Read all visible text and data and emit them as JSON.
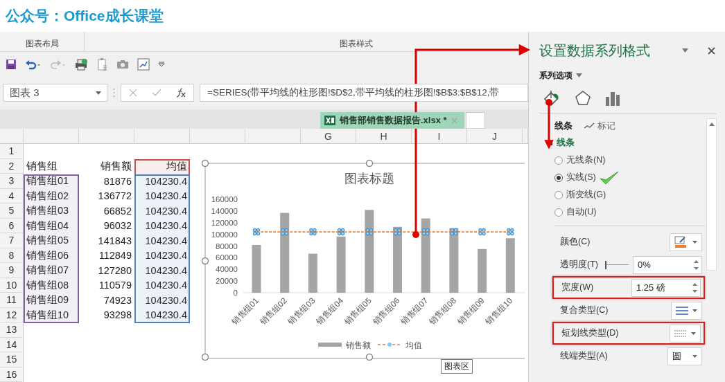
{
  "header": {
    "title": "公众号：Office成长课堂"
  },
  "ribbon": {
    "groups": [
      {
        "label": "图表布局"
      },
      {
        "label": "图表样式"
      }
    ]
  },
  "formula_bar": {
    "name_box": "图表 3",
    "formula": "=SERIES(带平均线的柱形图!$D$2,带平均线的柱形图!$B$3:$B$12,带"
  },
  "tabs": [
    {
      "label": "销售部销售数据报告.xlsx *",
      "selected": true
    }
  ],
  "columns": [
    "G",
    "H",
    "I",
    "J"
  ],
  "sheet": {
    "row_numbers": [
      "1",
      "2",
      "3",
      "4",
      "5",
      "6",
      "7",
      "8",
      "9",
      "10",
      "11",
      "12",
      "13",
      "14",
      "15",
      "16"
    ],
    "header": [
      "销售组",
      "销售额",
      "均值"
    ],
    "rows": [
      [
        "销售组01",
        "81876",
        "104230.4"
      ],
      [
        "销售组02",
        "136772",
        "104230.4"
      ],
      [
        "销售组03",
        "66852",
        "104230.4"
      ],
      [
        "销售组04",
        "96032",
        "104230.4"
      ],
      [
        "销售组05",
        "141843",
        "104230.4"
      ],
      [
        "销售组06",
        "112849",
        "104230.4"
      ],
      [
        "销售组07",
        "127280",
        "104230.4"
      ],
      [
        "销售组08",
        "110579",
        "104230.4"
      ],
      [
        "销售组09",
        "74923",
        "104230.4"
      ],
      [
        "销售组10",
        "93298",
        "104230.4"
      ]
    ]
  },
  "chart": {
    "tooltip": "图表区",
    "chart_data": {
      "type": "bar",
      "title": "图表标题",
      "categories": [
        "销售组01",
        "销售组02",
        "销售组03",
        "销售组04",
        "销售组05",
        "销售组06",
        "销售组07",
        "销售组08",
        "销售组09",
        "销售组10"
      ],
      "series": [
        {
          "name": "销售额",
          "type": "bar",
          "color": "#a5a5a5",
          "values": [
            81876,
            136772,
            66852,
            96032,
            141843,
            112849,
            127280,
            110579,
            74923,
            93298
          ]
        },
        {
          "name": "均值",
          "type": "line",
          "color": "#ed7d31",
          "line_style": "dashed",
          "marker": "cross",
          "values": [
            104230.4,
            104230.4,
            104230.4,
            104230.4,
            104230.4,
            104230.4,
            104230.4,
            104230.4,
            104230.4,
            104230.4
          ]
        }
      ],
      "legend": "bottom",
      "ylim": [
        0,
        160000
      ],
      "yticks": [
        0,
        20000,
        40000,
        60000,
        80000,
        100000,
        120000,
        140000,
        160000
      ]
    }
  },
  "pane": {
    "title": "设置数据系列格式",
    "series_options": "系列选项",
    "tabs": [
      {
        "label": "线条",
        "selected": true
      },
      {
        "label": "标记",
        "selected": false
      }
    ],
    "section": {
      "label": "线条"
    },
    "line_types": [
      {
        "label": "无线条(N)",
        "selected": false,
        "annotated": false
      },
      {
        "label": "实线(S)",
        "selected": true,
        "annotated": true
      },
      {
        "label": "渐变线(G)",
        "selected": false,
        "annotated": false
      },
      {
        "label": "自动(U)",
        "selected": false,
        "annotated": false
      }
    ],
    "properties": [
      {
        "kind": "color",
        "label": "颜色(C)",
        "highlighted": false
      },
      {
        "kind": "slider",
        "label": "透明度(T)",
        "level": 0,
        "value": "0%",
        "highlighted": false
      },
      {
        "kind": "spin",
        "label": "宽度(W)",
        "value": "1.25 磅",
        "highlighted": true
      },
      {
        "kind": "compound",
        "label": "复合类型(C)",
        "highlighted": false
      },
      {
        "kind": "dash",
        "label": "短划线类型(D)",
        "highlighted": true
      },
      {
        "kind": "dropdown",
        "label": "线端类型(A)",
        "value": "圆",
        "highlighted": false
      }
    ]
  }
}
